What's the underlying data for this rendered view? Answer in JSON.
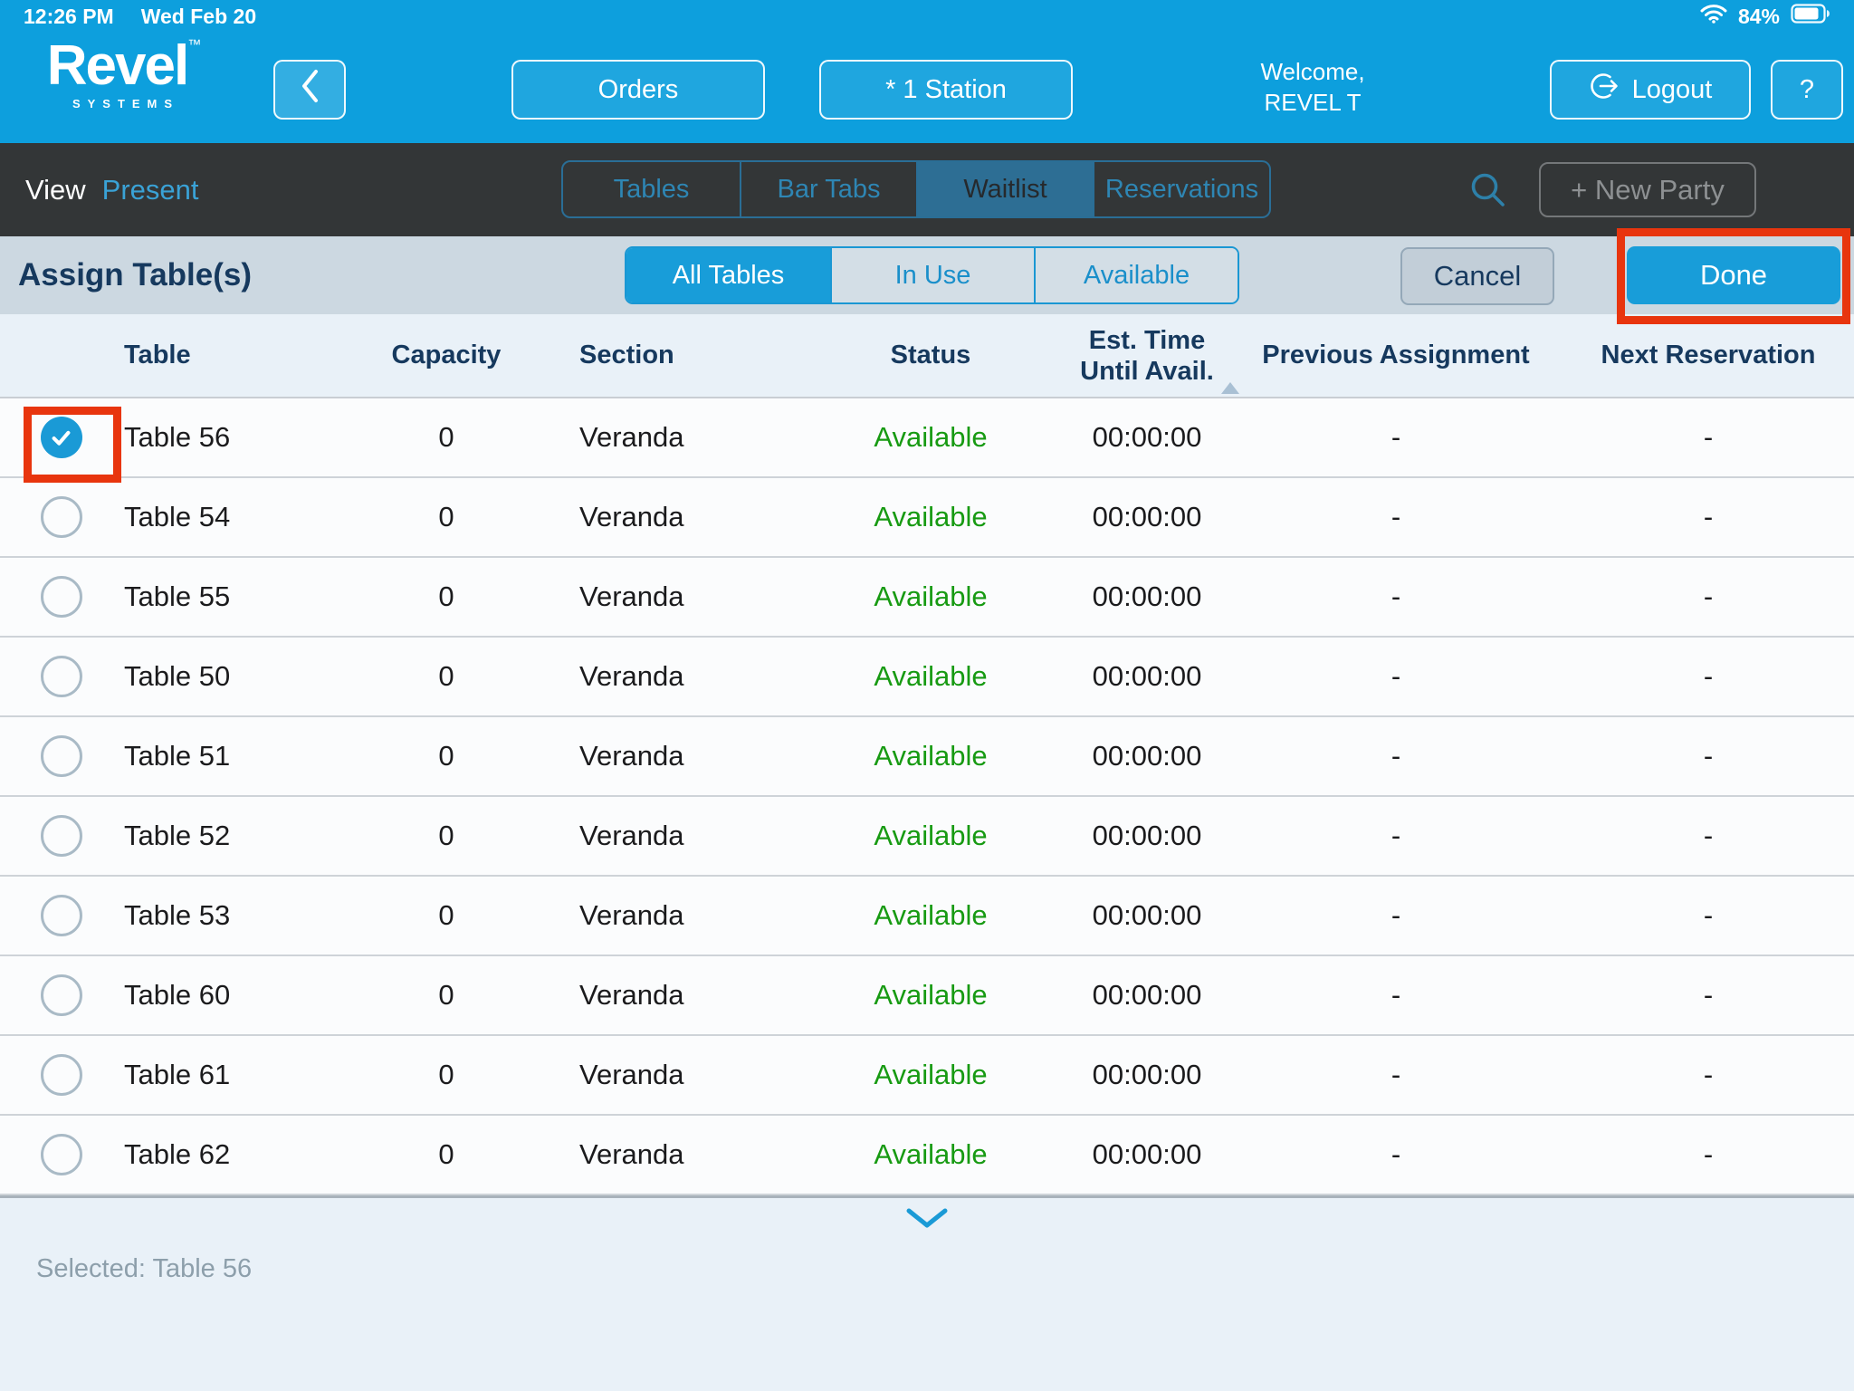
{
  "status_bar": {
    "time": "12:26 PM",
    "date": "Wed Feb 20",
    "battery_percent": "84%"
  },
  "header": {
    "logo_text": "Revel",
    "logo_tm": "™",
    "logo_subtext": "SYSTEMS",
    "orders_label": "Orders",
    "station_label": "* 1 Station",
    "welcome_line1": "Welcome,",
    "welcome_line2": "REVEL T",
    "logout_label": "Logout",
    "help_label": "?"
  },
  "nav": {
    "view_label": "View",
    "view_mode": "Present",
    "tabs": [
      {
        "label": "Tables",
        "selected": false
      },
      {
        "label": "Bar Tabs",
        "selected": false
      },
      {
        "label": "Waitlist",
        "selected": true
      },
      {
        "label": "Reservations",
        "selected": false
      }
    ],
    "new_party_label": "+ New Party"
  },
  "assign_bar": {
    "title": "Assign Table(s)",
    "filters": [
      {
        "label": "All Tables",
        "selected": true
      },
      {
        "label": "In Use",
        "selected": false
      },
      {
        "label": "Available",
        "selected": false
      }
    ],
    "cancel_label": "Cancel",
    "done_label": "Done"
  },
  "table": {
    "columns": {
      "table": "Table",
      "capacity": "Capacity",
      "section": "Section",
      "status": "Status",
      "est_line1": "Est. Time",
      "est_line2": "Until Avail.",
      "previous": "Previous Assignment",
      "next": "Next Reservation"
    },
    "rows": [
      {
        "name": "Table 56",
        "capacity": "0",
        "section": "Veranda",
        "status": "Available",
        "est_time": "00:00:00",
        "previous": "-",
        "next": "-",
        "selected": true,
        "annotated": true
      },
      {
        "name": "Table 54",
        "capacity": "0",
        "section": "Veranda",
        "status": "Available",
        "est_time": "00:00:00",
        "previous": "-",
        "next": "-",
        "selected": false,
        "annotated": false
      },
      {
        "name": "Table 55",
        "capacity": "0",
        "section": "Veranda",
        "status": "Available",
        "est_time": "00:00:00",
        "previous": "-",
        "next": "-",
        "selected": false,
        "annotated": false
      },
      {
        "name": "Table 50",
        "capacity": "0",
        "section": "Veranda",
        "status": "Available",
        "est_time": "00:00:00",
        "previous": "-",
        "next": "-",
        "selected": false,
        "annotated": false
      },
      {
        "name": "Table 51",
        "capacity": "0",
        "section": "Veranda",
        "status": "Available",
        "est_time": "00:00:00",
        "previous": "-",
        "next": "-",
        "selected": false,
        "annotated": false
      },
      {
        "name": "Table 52",
        "capacity": "0",
        "section": "Veranda",
        "status": "Available",
        "est_time": "00:00:00",
        "previous": "-",
        "next": "-",
        "selected": false,
        "annotated": false
      },
      {
        "name": "Table 53",
        "capacity": "0",
        "section": "Veranda",
        "status": "Available",
        "est_time": "00:00:00",
        "previous": "-",
        "next": "-",
        "selected": false,
        "annotated": false
      },
      {
        "name": "Table 60",
        "capacity": "0",
        "section": "Veranda",
        "status": "Available",
        "est_time": "00:00:00",
        "previous": "-",
        "next": "-",
        "selected": false,
        "annotated": false
      },
      {
        "name": "Table 61",
        "capacity": "0",
        "section": "Veranda",
        "status": "Available",
        "est_time": "00:00:00",
        "previous": "-",
        "next": "-",
        "selected": false,
        "annotated": false
      },
      {
        "name": "Table 62",
        "capacity": "0",
        "section": "Veranda",
        "status": "Available",
        "est_time": "00:00:00",
        "previous": "-",
        "next": "-",
        "selected": false,
        "annotated": false
      }
    ]
  },
  "footer": {
    "selected_label": "Selected: Table 56"
  },
  "colors": {
    "brand_blue": "#0d9fdd",
    "accent_blue": "#189dd9",
    "nav_dark": "#333637",
    "available_green": "#179a12",
    "annotation_red": "#e8350e"
  }
}
